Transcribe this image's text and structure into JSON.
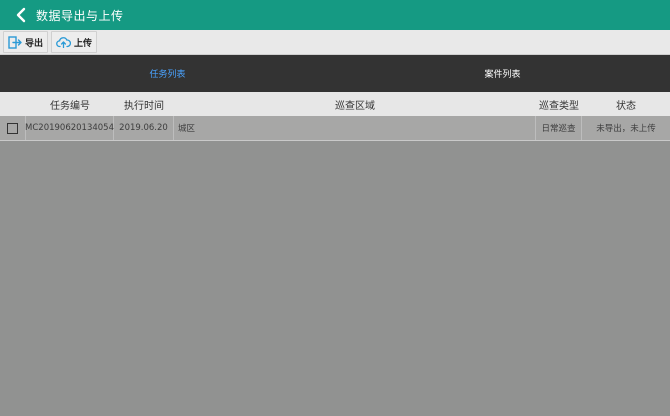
{
  "header": {
    "title": "数据导出与上传",
    "back_icon": "chevron-left-icon",
    "background": "#159a83"
  },
  "toolbar": {
    "export_label": "导出",
    "upload_label": "上传",
    "export_icon": "export-icon",
    "upload_icon": "cloud-upload-icon",
    "icon_color": "#2a9ad6"
  },
  "tabs": [
    {
      "label": "任务列表",
      "active": true
    },
    {
      "label": "案件列表",
      "active": false
    }
  ],
  "table": {
    "columns": [
      "",
      "任务编号",
      "执行时间",
      "巡查区域",
      "巡查类型",
      "状态"
    ],
    "rows": [
      {
        "checked": false,
        "task_id": "MC20190620134054",
        "exec_time": "2019.06.20",
        "area": "城区",
        "type": "日常巡查",
        "status": "未导出，未上传"
      }
    ]
  }
}
